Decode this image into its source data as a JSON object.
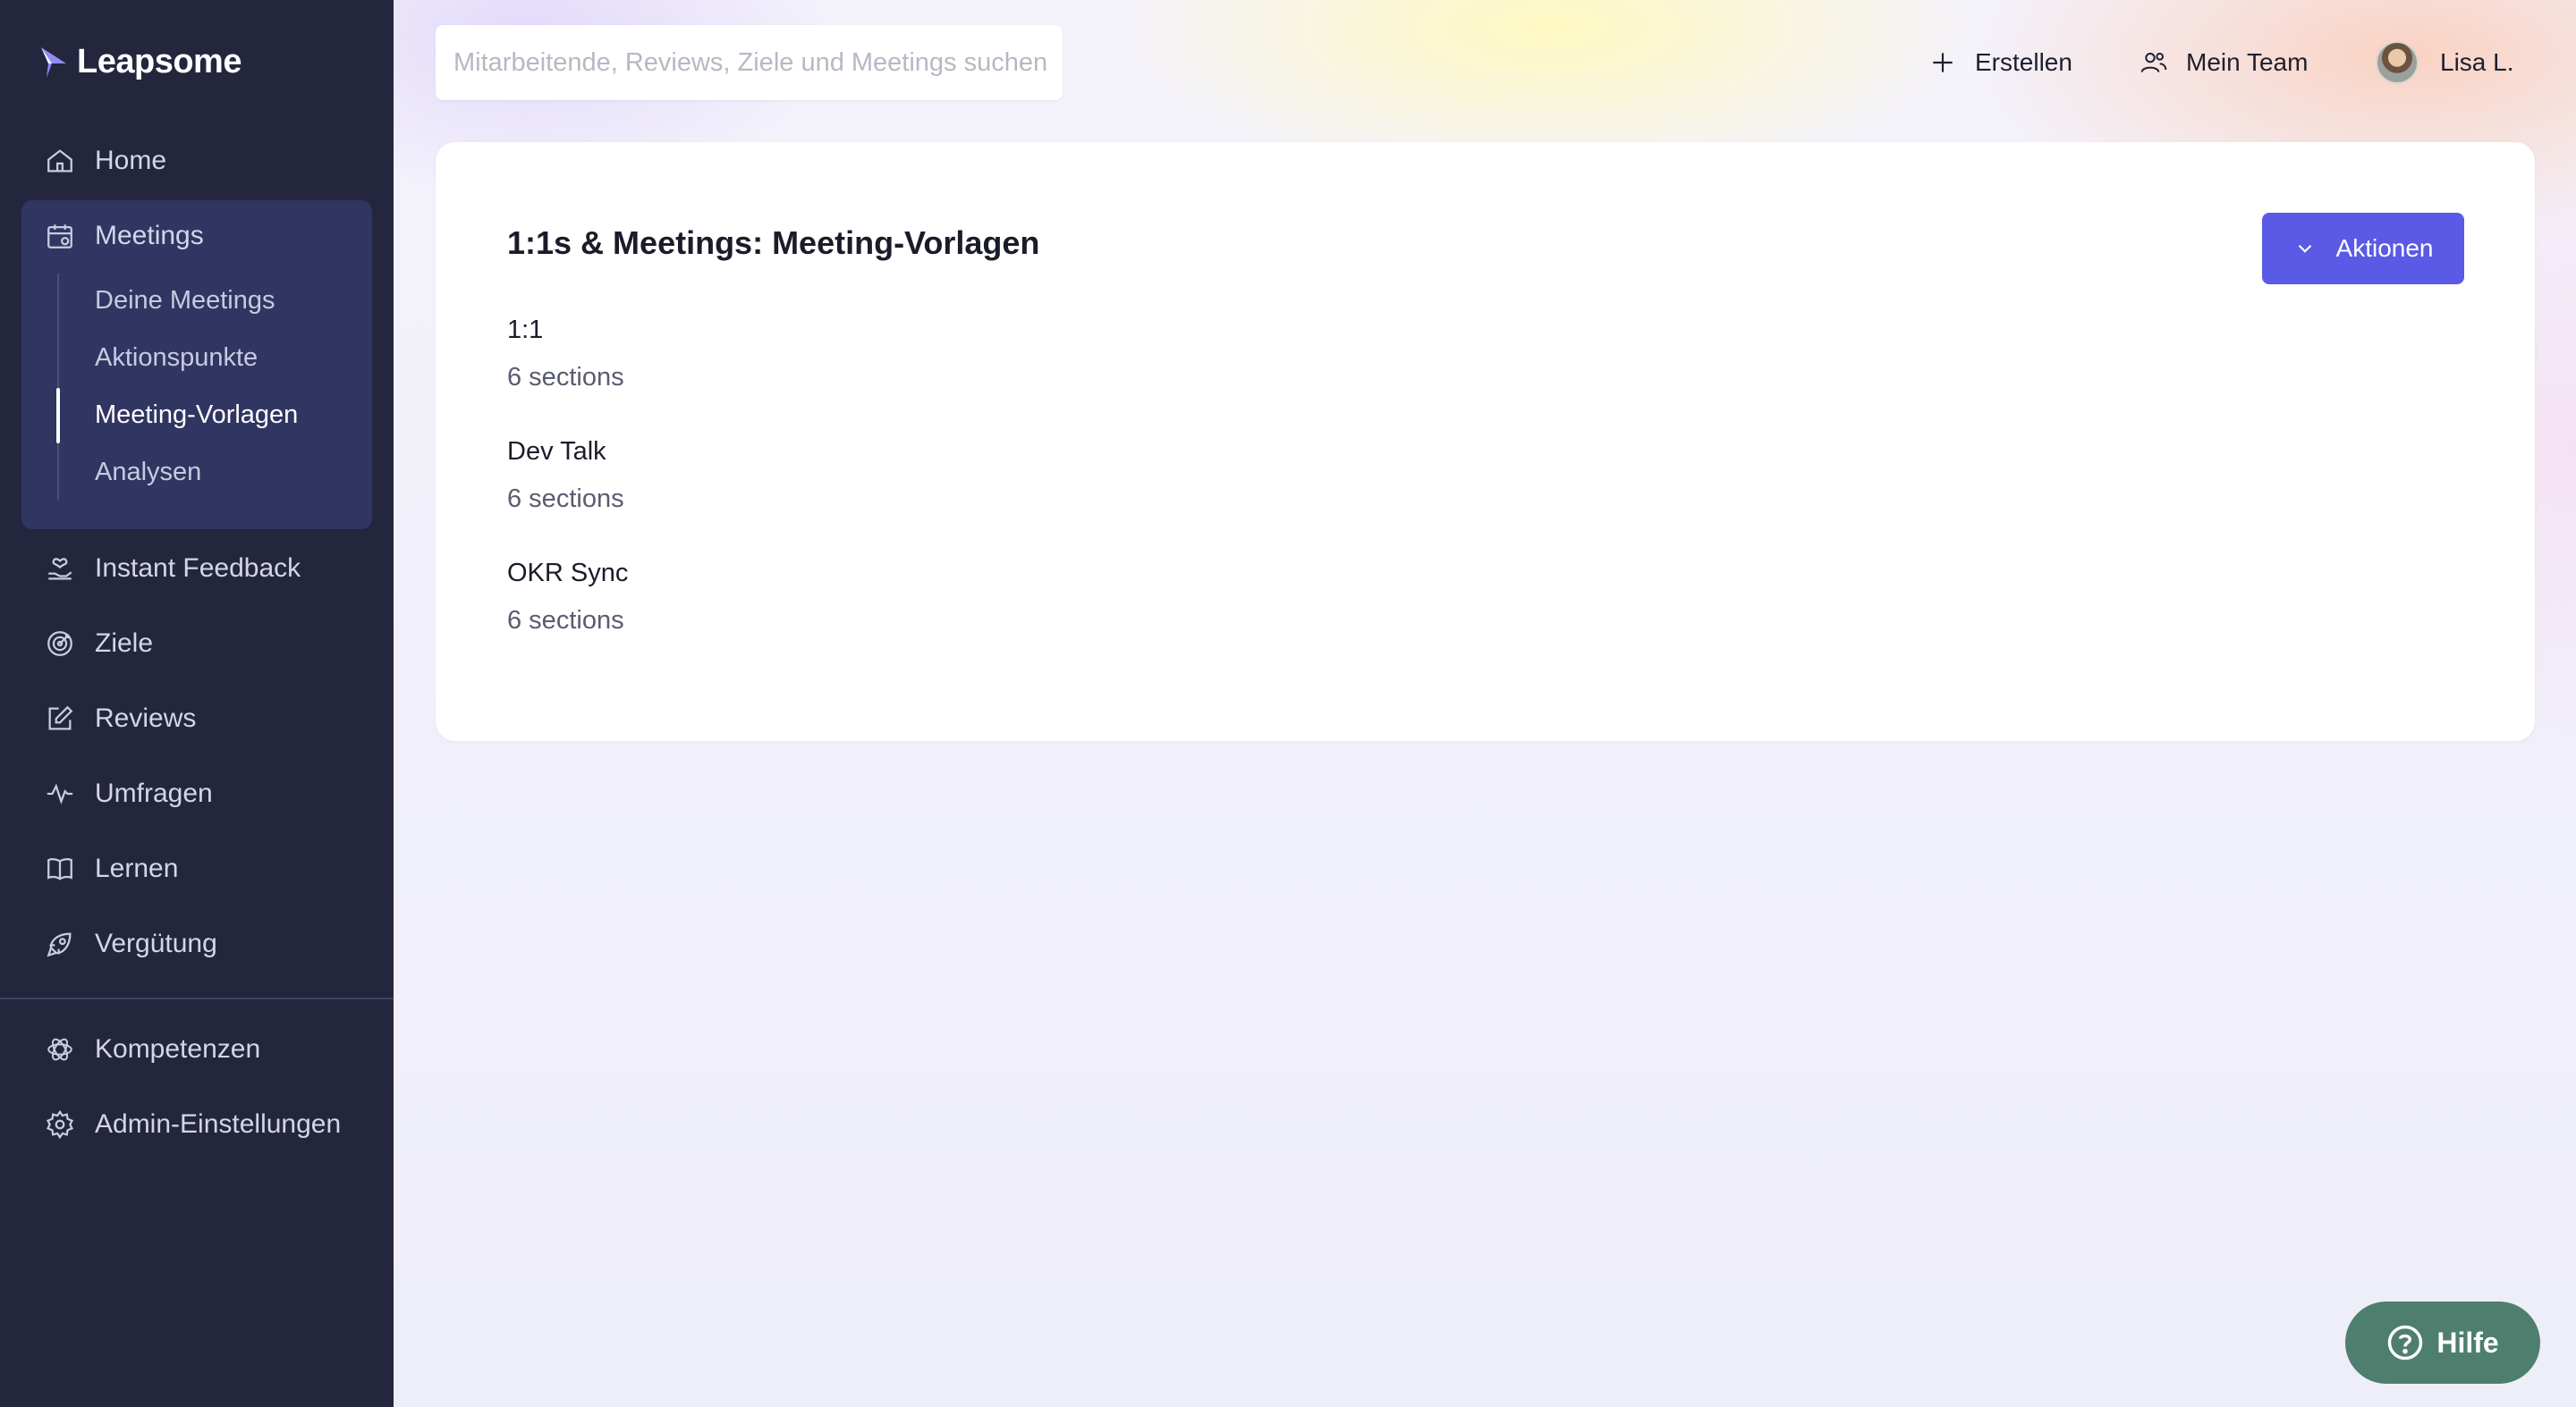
{
  "app": {
    "name": "Leapsome"
  },
  "search": {
    "placeholder": "Mitarbeitende, Reviews, Ziele und Meetings suchen"
  },
  "topbar": {
    "create_label": "Erstellen",
    "team_label": "Mein Team",
    "user_name": "Lisa L."
  },
  "sidebar": {
    "home": "Home",
    "meetings": "Meetings",
    "meetings_sub": {
      "deine": "Deine Meetings",
      "aktionspunkte": "Aktionspunkte",
      "vorlagen": "Meeting-Vorlagen",
      "analysen": "Analysen"
    },
    "instant_feedback": "Instant Feedback",
    "ziele": "Ziele",
    "reviews": "Reviews",
    "umfragen": "Umfragen",
    "lernen": "Lernen",
    "verguetung": "Vergütung",
    "kompetenzen": "Kompetenzen",
    "admin": "Admin-Einstellungen"
  },
  "main": {
    "title": "1:1s & Meetings: Meeting-Vorlagen",
    "actions_label": "Aktionen",
    "templates": [
      {
        "name": "1:1",
        "meta": "6 sections"
      },
      {
        "name": "Dev Talk",
        "meta": "6 sections"
      },
      {
        "name": "OKR Sync",
        "meta": "6 sections"
      }
    ]
  },
  "help": {
    "label": "Hilfe"
  },
  "colors": {
    "sidebar_bg": "#23263d",
    "active_group_bg": "#313562",
    "accent": "#5b5ae6",
    "help_bg": "#4e7f6e"
  }
}
